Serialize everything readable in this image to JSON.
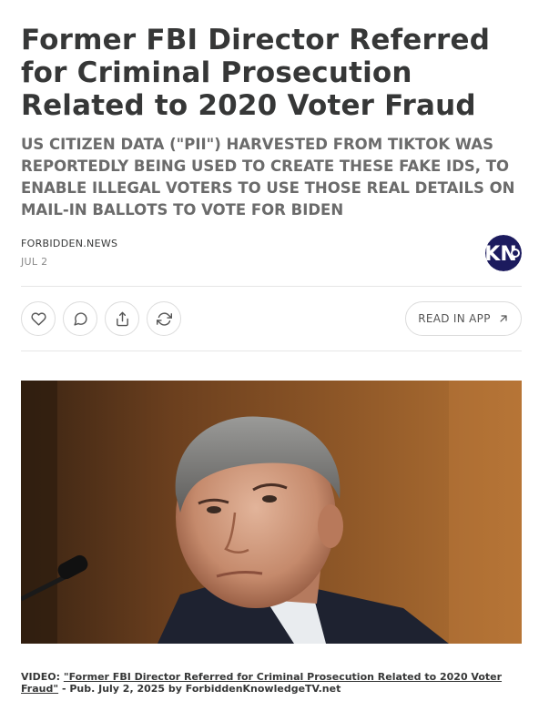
{
  "article": {
    "title": "Former FBI Director Referred for Criminal Prosecution Related to 2020 Voter Fraud",
    "subtitle": "US CITIZEN DATA (\"PII\") HARVESTED FROM TIKTOK WAS REPORTEDLY BEING USED TO CREATE THESE FAKE IDS, TO ENABLE ILLEGAL VOTERS TO USE THOSE REAL DETAILS ON MAIL-IN BALLOTS TO VOTE FOR BIDEN",
    "publisher": "FORBIDDEN.NEWS",
    "date": "JUL 2",
    "logo_text": "KN"
  },
  "actions": {
    "like_icon": "heart-icon",
    "comment_icon": "comment-icon",
    "share_icon": "share-icon",
    "restack_icon": "restack-icon",
    "read_in_app_label": "READ IN APP"
  },
  "caption": {
    "prefix": "VIDEO: ",
    "link_text": "\"Former FBI Director Referred for Criminal Prosecution Related to 2020 Voter Fraud\"",
    "suffix": " - Pub. July 2, 2025 by ForbiddenKnowledgeTV.net"
  },
  "colors": {
    "text": "#363737",
    "muted": "#6b6b6b",
    "logo_navy": "#1c1b5e",
    "border": "#dcdcdc"
  }
}
